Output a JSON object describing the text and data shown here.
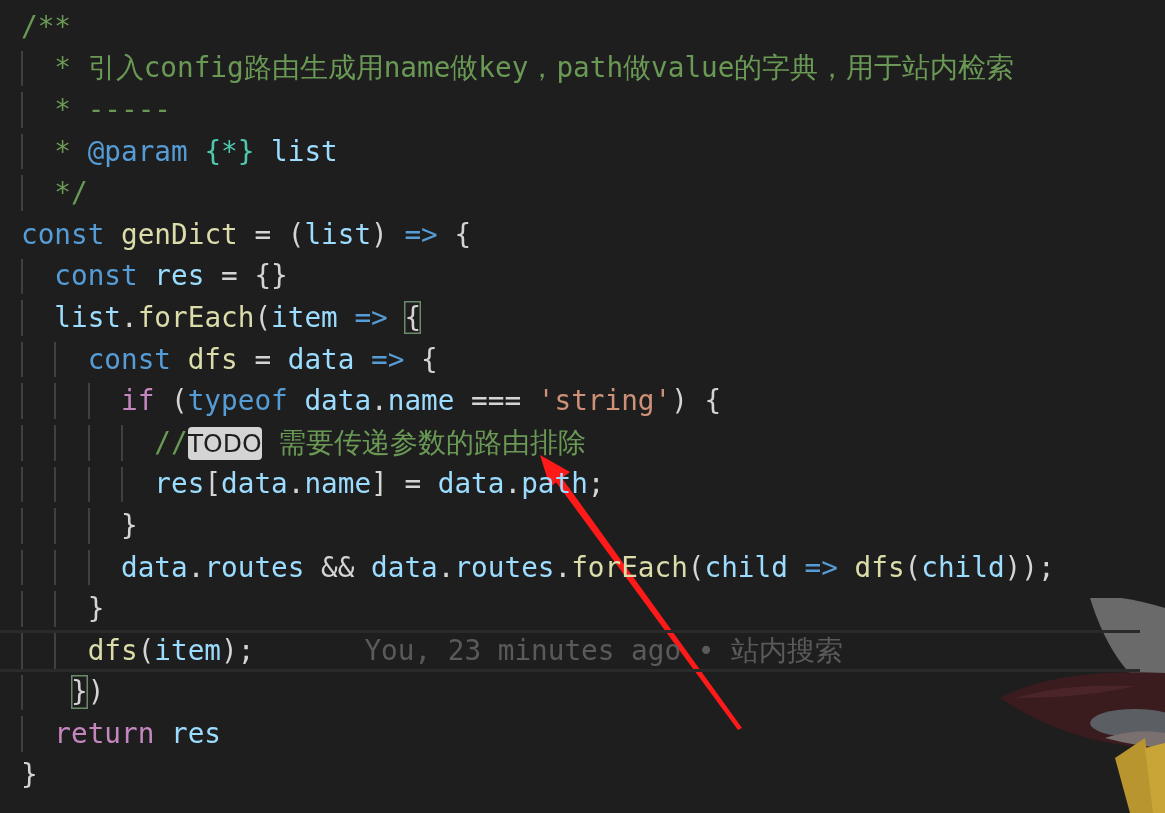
{
  "editor": {
    "lines": [
      {
        "current": false,
        "tokens": [
          {
            "text": "/**",
            "kind": "comment"
          }
        ]
      },
      {
        "current": false,
        "tokens": [
          {
            "text": "  * 引入config路由生成用name做key，path做value的字典，用于站内检索",
            "kind": "comment"
          }
        ]
      },
      {
        "current": false,
        "tokens": [
          {
            "text": "  * -----",
            "kind": "comment"
          }
        ]
      },
      {
        "current": false,
        "tokens": [
          {
            "text": "  * ",
            "kind": "comment"
          },
          {
            "text": "@param ",
            "kind": "doctag"
          },
          {
            "text": "{*} ",
            "kind": "type"
          },
          {
            "text": "list",
            "kind": "variable"
          }
        ]
      },
      {
        "current": false,
        "tokens": [
          {
            "text": "  */",
            "kind": "comment"
          }
        ]
      },
      {
        "current": false,
        "tokens": [
          {
            "text": "const ",
            "kind": "keyword"
          },
          {
            "text": "genDict",
            "kind": "function"
          },
          {
            "text": " = (",
            "kind": "punct"
          },
          {
            "text": "list",
            "kind": "variable"
          },
          {
            "text": ") ",
            "kind": "punct"
          },
          {
            "text": "=>",
            "kind": "keyword"
          },
          {
            "text": " {",
            "kind": "punct"
          }
        ]
      },
      {
        "current": false,
        "tokens": [
          {
            "text": "  const ",
            "kind": "keyword"
          },
          {
            "text": "res",
            "kind": "variable"
          },
          {
            "text": " = {}",
            "kind": "punct"
          }
        ]
      },
      {
        "current": false,
        "tokens": [
          {
            "text": "  list",
            "kind": "variable"
          },
          {
            "text": ".",
            "kind": "punct"
          },
          {
            "text": "forEach",
            "kind": "function"
          },
          {
            "text": "(",
            "kind": "punct"
          },
          {
            "text": "item",
            "kind": "variable"
          },
          {
            "text": " =>",
            "kind": "keyword"
          },
          {
            "text": "{",
            "kind": "bracket"
          }
        ]
      },
      {
        "current": false,
        "tokens": [
          {
            "text": "    const ",
            "kind": "keyword"
          },
          {
            "text": "dfs",
            "kind": "function"
          },
          {
            "text": " = ",
            "kind": "punct"
          },
          {
            "text": "data",
            "kind": "variable"
          },
          {
            "text": " =>",
            "kind": "keyword"
          },
          {
            "text": " {",
            "kind": "punct"
          }
        ]
      },
      {
        "current": false,
        "tokens": [
          {
            "text": "      if",
            "kind": "control"
          },
          {
            "text": " (",
            "kind": "punct"
          },
          {
            "text": "typeof ",
            "kind": "keyword"
          },
          {
            "text": "data",
            "kind": "variable"
          },
          {
            "text": ".",
            "kind": "punct"
          },
          {
            "text": "name",
            "kind": "variable"
          },
          {
            "text": " === ",
            "kind": "punct"
          },
          {
            "text": "'string'",
            "kind": "string"
          },
          {
            "text": ") {",
            "kind": "punct"
          }
        ]
      },
      {
        "current": false,
        "tokens": [
          {
            "text": "        //",
            "kind": "comment"
          },
          {
            "text": "TODO",
            "kind": "todo"
          },
          {
            "text": " 需要传递参数的路由排除",
            "kind": "comment"
          }
        ]
      },
      {
        "current": false,
        "tokens": [
          {
            "text": "        res",
            "kind": "variable"
          },
          {
            "text": "[",
            "kind": "punct"
          },
          {
            "text": "data",
            "kind": "variable"
          },
          {
            "text": ".",
            "kind": "punct"
          },
          {
            "text": "name",
            "kind": "variable"
          },
          {
            "text": "] = ",
            "kind": "punct"
          },
          {
            "text": "data",
            "kind": "variable"
          },
          {
            "text": ".",
            "kind": "punct"
          },
          {
            "text": "path",
            "kind": "variable"
          },
          {
            "text": ";",
            "kind": "punct"
          }
        ]
      },
      {
        "current": false,
        "tokens": [
          {
            "text": "      }",
            "kind": "punct"
          }
        ]
      },
      {
        "current": false,
        "tokens": [
          {
            "text": "      data",
            "kind": "variable"
          },
          {
            "text": ".",
            "kind": "punct"
          },
          {
            "text": "routes",
            "kind": "variable"
          },
          {
            "text": " && ",
            "kind": "punct"
          },
          {
            "text": "data",
            "kind": "variable"
          },
          {
            "text": ".",
            "kind": "punct"
          },
          {
            "text": "routes",
            "kind": "variable"
          },
          {
            "text": ".",
            "kind": "punct"
          },
          {
            "text": "forEach",
            "kind": "function"
          },
          {
            "text": "(",
            "kind": "punct"
          },
          {
            "text": "child",
            "kind": "variable"
          },
          {
            "text": " =>",
            "kind": "keyword"
          },
          {
            "text": " dfs",
            "kind": "function"
          },
          {
            "text": "(",
            "kind": "punct"
          },
          {
            "text": "child",
            "kind": "variable"
          },
          {
            "text": "));",
            "kind": "punct"
          }
        ]
      },
      {
        "current": false,
        "tokens": [
          {
            "text": "    }",
            "kind": "punct"
          }
        ]
      },
      {
        "current": true,
        "blame": "You, 23 minutes ago • 站内搜索",
        "tokens": [
          {
            "text": "    dfs",
            "kind": "function"
          },
          {
            "text": "(",
            "kind": "punct"
          },
          {
            "text": "item",
            "kind": "variable"
          },
          {
            "text": ");",
            "kind": "punct"
          }
        ]
      },
      {
        "current": false,
        "tokens": [
          {
            "text": "  }",
            "kind": "bracket"
          },
          {
            "text": ")",
            "kind": "punct"
          }
        ]
      },
      {
        "current": false,
        "tokens": [
          {
            "text": "  return ",
            "kind": "control"
          },
          {
            "text": "res",
            "kind": "variable"
          }
        ]
      },
      {
        "current": false,
        "tokens": [
          {
            "text": "}",
            "kind": "punct"
          }
        ]
      }
    ]
  }
}
